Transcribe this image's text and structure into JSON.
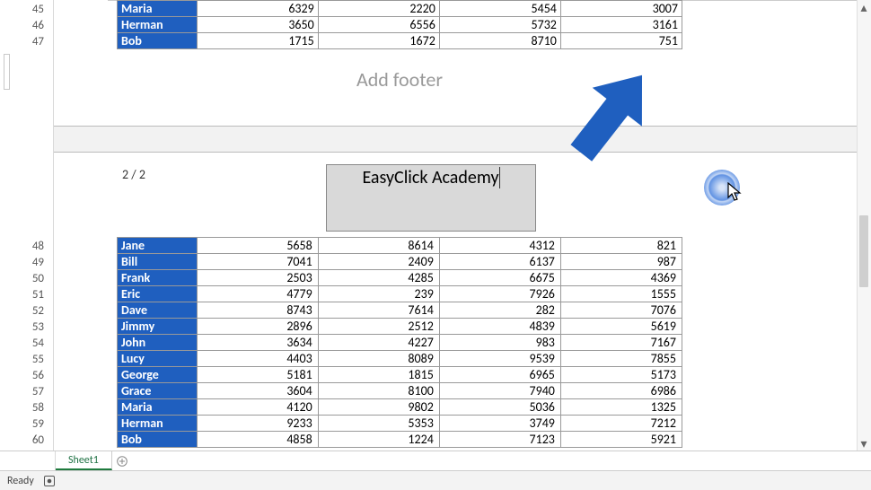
{
  "upper_rows_start": 45,
  "upper_rows": [
    {
      "name": "Maria",
      "c1": 6329,
      "c2": 2220,
      "c3": 5454,
      "c4": 3007
    },
    {
      "name": "Herman",
      "c1": 3650,
      "c2": 6556,
      "c3": 5732,
      "c4": 3161
    },
    {
      "name": "Bob",
      "c1": 1715,
      "c2": 1672,
      "c3": 8710,
      "c4": 751
    }
  ],
  "add_footer_text": "Add footer",
  "header": {
    "page_indicator": "2 / 2",
    "center_input": "EasyClick Academy"
  },
  "lower_rows_start": 48,
  "lower_rows": [
    {
      "name": "Jane",
      "c1": 5658,
      "c2": 8614,
      "c3": 4312,
      "c4": 821
    },
    {
      "name": "Bill",
      "c1": 7041,
      "c2": 2409,
      "c3": 6137,
      "c4": 987
    },
    {
      "name": "Frank",
      "c1": 2503,
      "c2": 4285,
      "c3": 6675,
      "c4": 4369
    },
    {
      "name": "Eric",
      "c1": 4779,
      "c2": 239,
      "c3": 7926,
      "c4": 1555
    },
    {
      "name": "Dave",
      "c1": 8743,
      "c2": 7614,
      "c3": 282,
      "c4": 7076
    },
    {
      "name": "Jimmy",
      "c1": 2896,
      "c2": 2512,
      "c3": 4839,
      "c4": 5619
    },
    {
      "name": "John",
      "c1": 3634,
      "c2": 4227,
      "c3": 983,
      "c4": 7167
    },
    {
      "name": "Lucy",
      "c1": 4403,
      "c2": 8089,
      "c3": 9539,
      "c4": 7855
    },
    {
      "name": "George",
      "c1": 5181,
      "c2": 1815,
      "c3": 6965,
      "c4": 5173
    },
    {
      "name": "Grace",
      "c1": 3604,
      "c2": 8100,
      "c3": 7940,
      "c4": 6986
    },
    {
      "name": "Maria",
      "c1": 4120,
      "c2": 9802,
      "c3": 5036,
      "c4": 1325
    },
    {
      "name": "Herman",
      "c1": 9233,
      "c2": 5353,
      "c3": 3749,
      "c4": 7212
    },
    {
      "name": "Bob",
      "c1": 4858,
      "c2": 1224,
      "c3": 7123,
      "c4": 5921
    }
  ],
  "tabs": {
    "active": "Sheet1"
  },
  "status": {
    "label": "Ready"
  },
  "accent_arrow_color": "#1f5fbf"
}
